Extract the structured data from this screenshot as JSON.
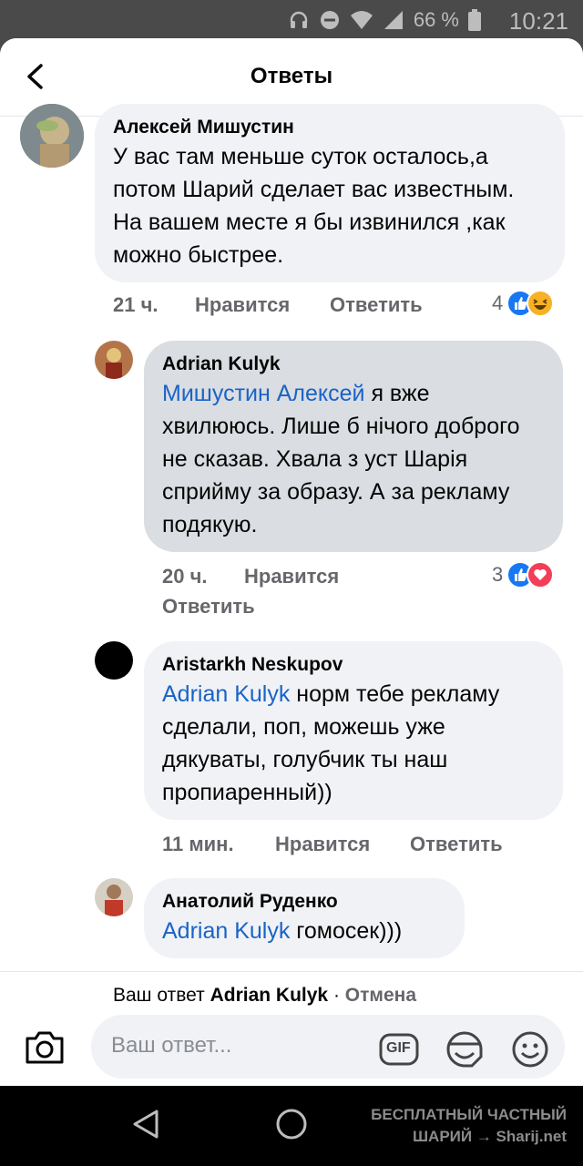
{
  "status_bar": {
    "battery_text": "66 %",
    "time": "10:21"
  },
  "header": {
    "title": "Ответы"
  },
  "comments": [
    {
      "author": "Алексей Мишустин",
      "text": "У вас там меньше суток осталось,а потом Шарий сделает вас известным. На вашем месте я бы извинился ,как можно быстрее.",
      "time": "21 ч.",
      "like_label": "Нравится",
      "reply_label": "Ответить",
      "reaction_count": "4",
      "reactions": [
        "like",
        "haha"
      ]
    },
    {
      "author": "Adrian Kulyk",
      "mention": "Мишустин Алексей",
      "text": " я вже хвилююсь. Лише б нічого доброго не сказав. Хвала з уст Шарія сприйму за образу. А за рекламу подякую.",
      "time": "20 ч.",
      "like_label": "Нравится",
      "reply_label": "Ответить",
      "reaction_count": "3",
      "reactions": [
        "like",
        "love"
      ]
    },
    {
      "author": "Aristarkh Neskupov",
      "mention": "Adrian Kulyk",
      "text": " норм тебе рекламу сделали, поп, можешь уже дякуваты, голубчик ты наш пропиаренный))",
      "time": "11 мин.",
      "like_label": "Нравится",
      "reply_label": "Ответить"
    },
    {
      "author": "Анатолий Руденко",
      "mention": "Adrian Kulyk",
      "text": " гомосек)))"
    }
  ],
  "reply_bar": {
    "prefix": "Ваш ответ",
    "target": "Adrian Kulyk",
    "separator": "·",
    "cancel": "Отмена"
  },
  "composer": {
    "placeholder": "Ваш ответ...",
    "gif_label": "GIF"
  },
  "watermark": {
    "line1": "БЕСПЛАТНЫЙ ЧАСТНЫЙ",
    "line2": "ШАРИЙ → Sharij.net"
  },
  "colors": {
    "mention": "#1a63c7",
    "like": "#1877f2",
    "love": "#f33e58",
    "haha": "#f7b125",
    "bubble": "#f0f2f5",
    "bubble_highlight": "#dadde1"
  }
}
